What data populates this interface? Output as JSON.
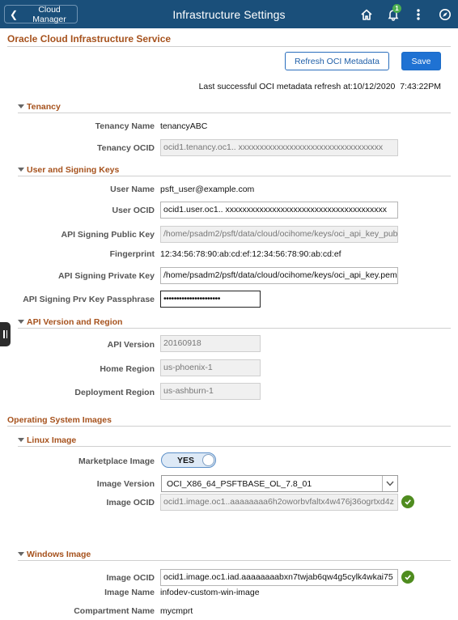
{
  "header": {
    "back_label": "Cloud Manager",
    "title": "Infrastructure Settings",
    "notification_count": "1",
    "icons": [
      "home-icon",
      "bell-icon",
      "more-vertical-icon",
      "compass-icon"
    ]
  },
  "page": {
    "title": "Oracle Cloud Infrastructure Service",
    "refresh_button": "Refresh OCI Metadata",
    "save_button": "Save",
    "refresh_status": "Last successful OCI metadata refresh at:10/12/2020  7:43:22PM"
  },
  "tenancy": {
    "section_title": "Tenancy",
    "name_label": "Tenancy Name",
    "name_value": "tenancyABC",
    "ocid_label": "Tenancy OCID",
    "ocid_value": "ocid1.tenancy.oc1.. xxxxxxxxxxxxxxxxxxxxxxxxxxxxxxxxxx"
  },
  "user_keys": {
    "section_title": "User and Signing Keys",
    "user_name_label": "User Name",
    "user_name_value": "psft_user@example.com",
    "user_ocid_label": "User OCID",
    "user_ocid_value": "ocid1.user.oc1.. xxxxxxxxxxxxxxxxxxxxxxxxxxxxxxxxxxxxxx",
    "public_key_label": "API Signing Public Key",
    "public_key_value": "/home/psadm2/psft/data/cloud/ocihome/keys/oci_api_key_pub",
    "fingerprint_label": "Fingerprint",
    "fingerprint_value": "12:34:56:78:90:ab:cd:ef:12:34:56:78:90:ab:cd:ef",
    "private_key_label": "API Signing Private Key",
    "private_key_value": "/home/psadm2/psft/data/cloud/ocihome/keys/oci_api_key.pem",
    "passphrase_label": "API Signing Prv Key Passphrase",
    "passphrase_value": "••••••••••••••••••••••"
  },
  "api_region": {
    "section_title": "API Version and Region",
    "api_version_label": "API Version",
    "api_version_value": "20160918",
    "home_region_label": "Home Region",
    "home_region_value": "us-phoenix-1",
    "deployment_region_label": "Deployment Region",
    "deployment_region_value": "us-ashburn-1"
  },
  "os_images": {
    "section_title": "Operating System Images",
    "linux": {
      "section_title": "Linux Image",
      "marketplace_label": "Marketplace Image",
      "marketplace_value": "YES",
      "version_label": "Image Version",
      "version_value": "OCI_X86_64_PSFTBASE_OL_7.8_01",
      "ocid_label": "Image OCID",
      "ocid_value": "ocid1.image.oc1..aaaaaaaa6h2oworbvfaltx4w476j36ogrtxd4z"
    },
    "windows": {
      "section_title": "Windows Image",
      "ocid_label": "Image OCID",
      "ocid_value": "ocid1.image.oc1.iad.aaaaaaaabxn7twjab6qw4g5cylk4wkai75",
      "name_label": "Image Name",
      "name_value": "infodev-custom-win-image",
      "compartment_label": "Compartment Name",
      "compartment_value": "mycmprt"
    }
  },
  "colors": {
    "header_bg": "#1a4f7a",
    "section_title": "#a6521d",
    "primary_button": "#1f72d3",
    "success_check": "#4f8c1f"
  }
}
